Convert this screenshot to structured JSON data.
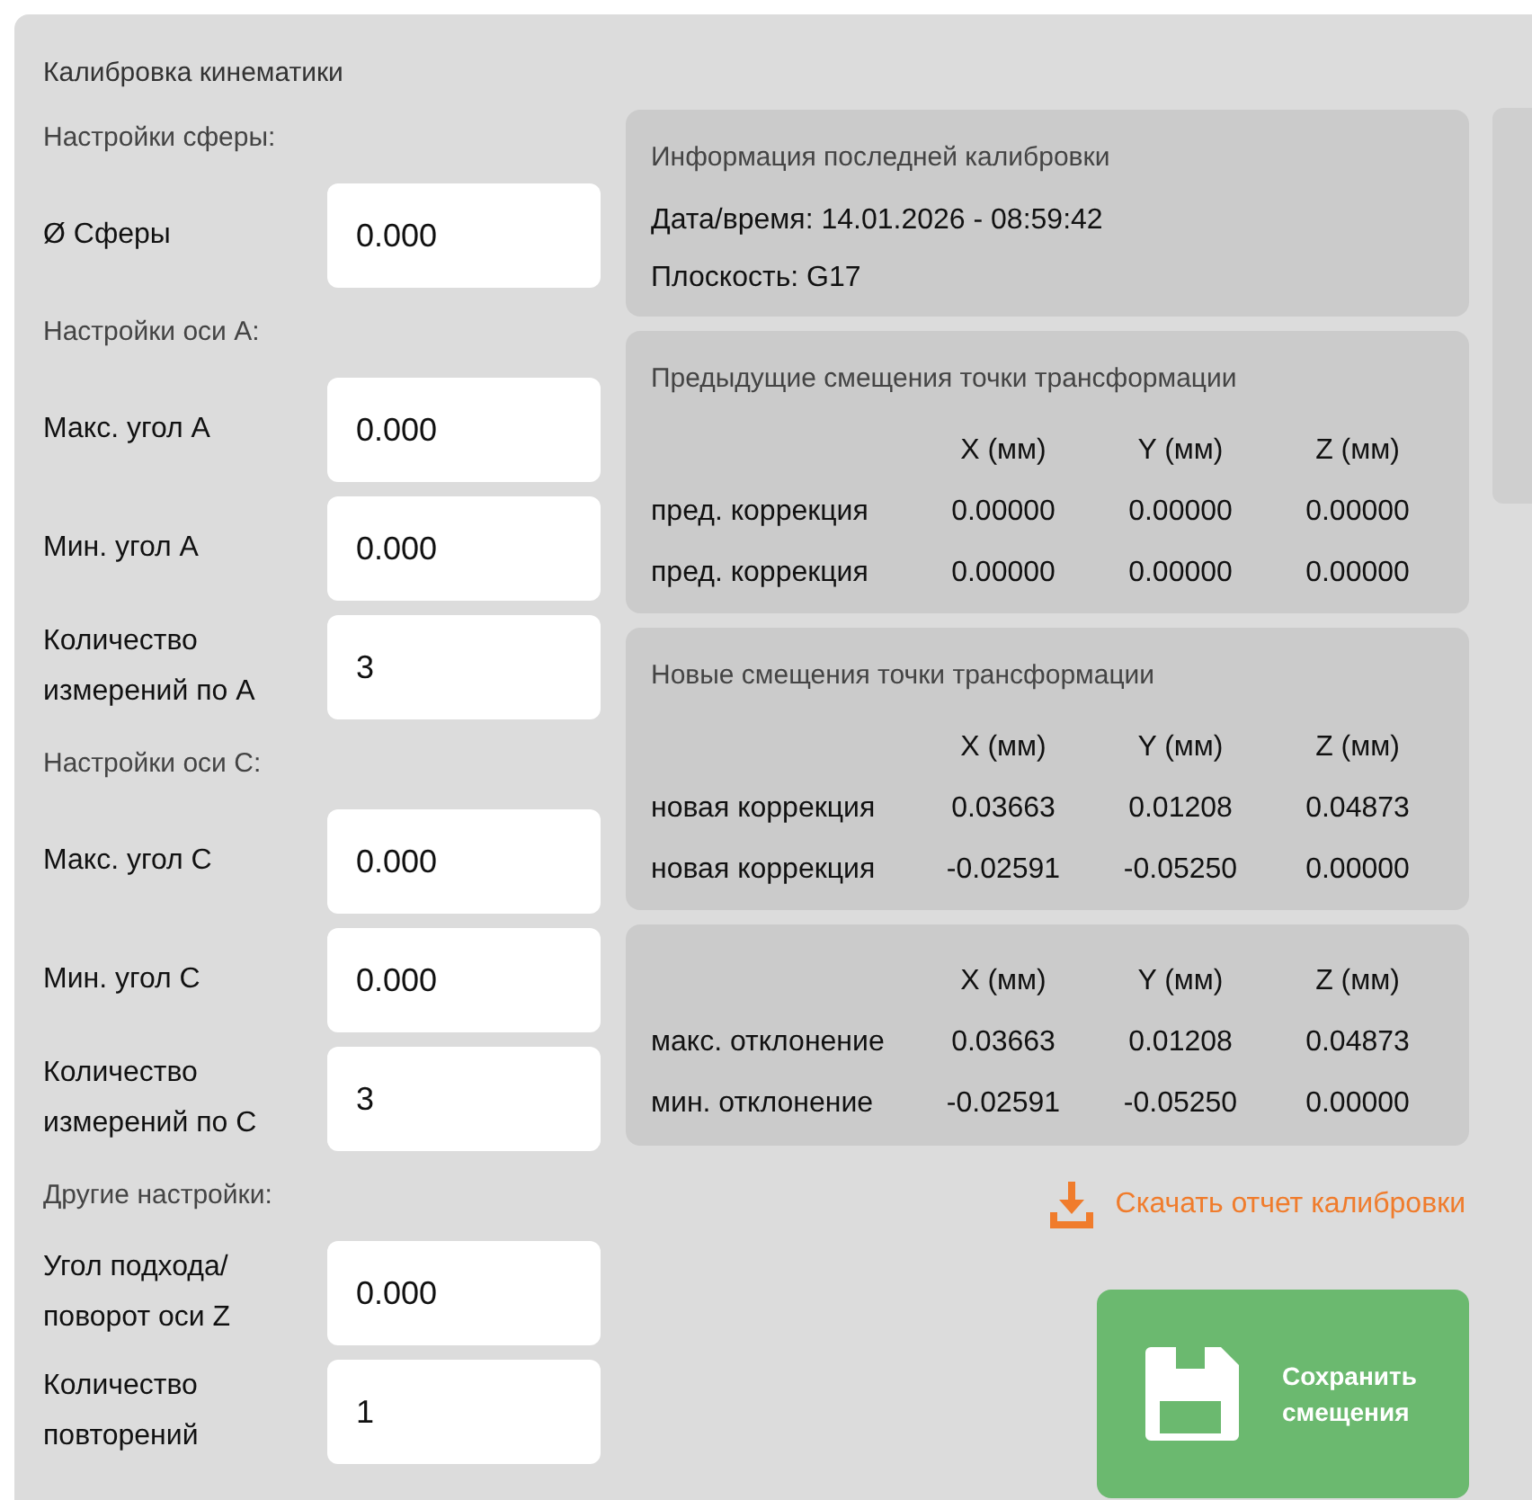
{
  "title": "Калибровка кинематики",
  "settings": [
    {
      "heading": "Настройки сферы:",
      "fields": [
        {
          "label": "Ø Сферы",
          "value": "0.000"
        }
      ]
    },
    {
      "heading": "Настройки оси A:",
      "fields": [
        {
          "label": "Макс. угол A",
          "value": "0.000"
        },
        {
          "label": "Мин. угол A",
          "value": "0.000"
        },
        {
          "label": "Количество измерений по A",
          "value": "3"
        }
      ]
    },
    {
      "heading": "Настройки оси C:",
      "fields": [
        {
          "label": "Макс. угол C",
          "value": "0.000"
        },
        {
          "label": "Мин. угол C",
          "value": "0.000"
        },
        {
          "label": "Количество измерений по C",
          "value": "3"
        }
      ]
    },
    {
      "heading": "Другие настройки:",
      "fields": [
        {
          "label": "Угол подхода/ поворот оси Z",
          "value": "0.000"
        },
        {
          "label": "Количество повторений",
          "value": "1"
        }
      ]
    }
  ],
  "last_calibration": {
    "title": "Информация последней калибровки",
    "lines": [
      "Дата/время: 14.01.2026 - 08:59:42",
      "Плоскость: G17"
    ]
  },
  "tables": [
    {
      "title": "Предыдущие смещения точки трансформации",
      "columns": [
        "X (мм)",
        "Y (мм)",
        "Z (мм)"
      ],
      "rows": [
        {
          "label": "пред. коррекция",
          "values": [
            "0.00000",
            "0.00000",
            "0.00000"
          ]
        },
        {
          "label": "пред. коррекция",
          "values": [
            "0.00000",
            "0.00000",
            "0.00000"
          ]
        }
      ]
    },
    {
      "title": "Новые смещения точки трансформации",
      "columns": [
        "X (мм)",
        "Y (мм)",
        "Z (мм)"
      ],
      "rows": [
        {
          "label": "новая коррекция",
          "values": [
            "0.03663",
            "0.01208",
            "0.04873"
          ]
        },
        {
          "label": "новая коррекция",
          "values": [
            "-0.02591",
            "-0.05250",
            "0.00000"
          ]
        }
      ]
    },
    {
      "columns": [
        "X (мм)",
        "Y (мм)",
        "Z (мм)"
      ],
      "rows": [
        {
          "label": "макс. отклонение",
          "values": [
            "0.03663",
            "0.01208",
            "0.04873"
          ]
        },
        {
          "label": "мин. отклонение",
          "values": [
            "-0.02591",
            "-0.05250",
            "0.00000"
          ]
        }
      ]
    }
  ],
  "download_link": "Скачать отчет калибровки",
  "save_button": "Сохранить смещения"
}
